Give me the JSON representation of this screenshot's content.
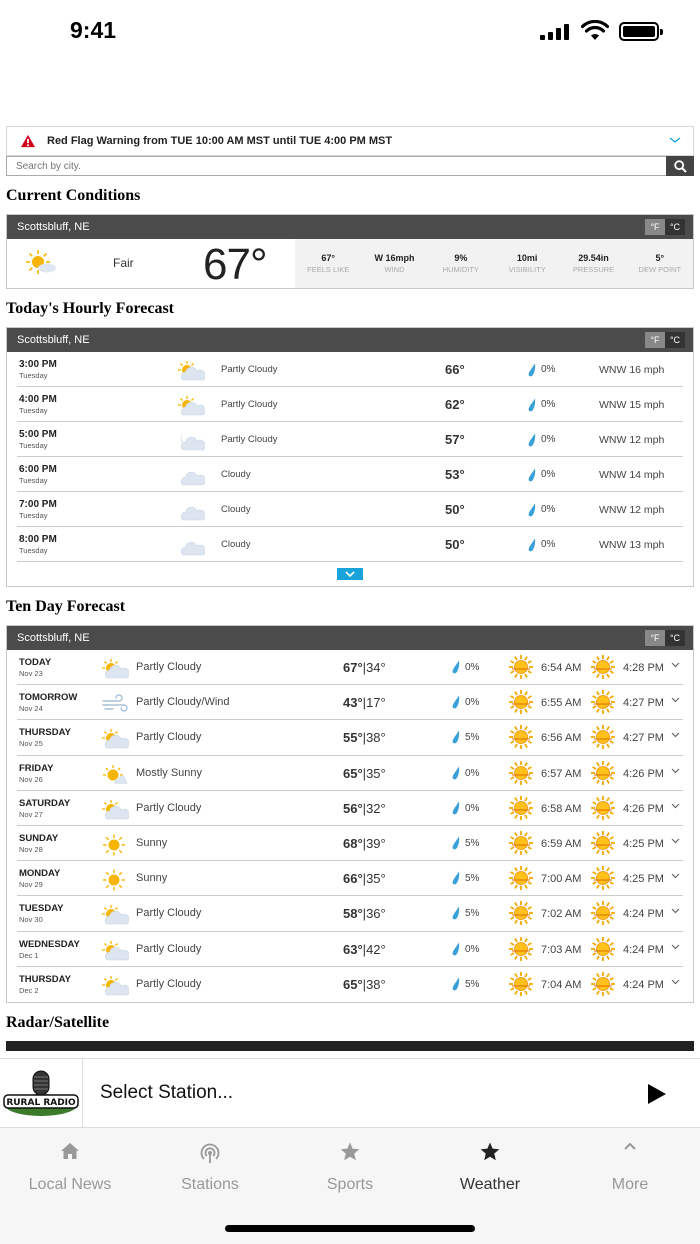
{
  "status_bar": {
    "time": "9:41"
  },
  "alert": {
    "text": "Red Flag Warning from TUE 10:00 AM MST until TUE 4:00 PM MST"
  },
  "search": {
    "placeholder": "Search by city."
  },
  "current": {
    "heading": "Current Conditions",
    "location": "Scottsbluff, NE",
    "unit_f": "°F",
    "unit_c": "°C",
    "condition": "Fair",
    "temp": "67°",
    "stats": [
      {
        "value": "67°",
        "label": "FEELS LIKE"
      },
      {
        "value": "W 16mph",
        "label": "WIND"
      },
      {
        "value": "9%",
        "label": "HUMIDITY"
      },
      {
        "value": "10mi",
        "label": "VISIBILITY"
      },
      {
        "value": "29.54in",
        "label": "PRESSURE"
      },
      {
        "value": "5°",
        "label": "DEW POINT"
      }
    ]
  },
  "hourly": {
    "heading": "Today's Hourly Forecast",
    "location": "Scottsbluff, NE",
    "rows": [
      {
        "time": "3:00 PM",
        "day": "Tuesday",
        "icon": "partly-cloudy-icon",
        "cond": "Partly Cloudy",
        "temp": "66°",
        "precip": "0%",
        "wind": "WNW 16 mph"
      },
      {
        "time": "4:00 PM",
        "day": "Tuesday",
        "icon": "partly-cloudy-icon",
        "cond": "Partly Cloudy",
        "temp": "62°",
        "precip": "0%",
        "wind": "WNW 15 mph"
      },
      {
        "time": "5:00 PM",
        "day": "Tuesday",
        "icon": "partly-cloudy-night-icon",
        "cond": "Partly Cloudy",
        "temp": "57°",
        "precip": "0%",
        "wind": "WNW 12 mph"
      },
      {
        "time": "6:00 PM",
        "day": "Tuesday",
        "icon": "cloudy-icon",
        "cond": "Cloudy",
        "temp": "53°",
        "precip": "0%",
        "wind": "WNW 14 mph"
      },
      {
        "time": "7:00 PM",
        "day": "Tuesday",
        "icon": "cloudy-icon",
        "cond": "Cloudy",
        "temp": "50°",
        "precip": "0%",
        "wind": "WNW 12 mph"
      },
      {
        "time": "8:00 PM",
        "day": "Tuesday",
        "icon": "cloudy-icon",
        "cond": "Cloudy",
        "temp": "50°",
        "precip": "0%",
        "wind": "WNW 13 mph"
      }
    ]
  },
  "tenday": {
    "heading": "Ten Day Forecast",
    "location": "Scottsbluff, NE",
    "rows": [
      {
        "day": "TODAY",
        "date": "Nov 23",
        "icon": "partly-cloudy-icon",
        "cond": "Partly Cloudy",
        "hi": "67°",
        "lo": "34°",
        "precip": "0%",
        "sunrise": "6:54 AM",
        "sunset": "4:28 PM"
      },
      {
        "day": "TOMORROW",
        "date": "Nov 24",
        "icon": "wind-icon",
        "cond": "Partly Cloudy/Wind",
        "hi": "43°",
        "lo": "17°",
        "precip": "0%",
        "sunrise": "6:55 AM",
        "sunset": "4:27 PM"
      },
      {
        "day": "THURSDAY",
        "date": "Nov 25",
        "icon": "partly-cloudy-icon",
        "cond": "Partly Cloudy",
        "hi": "55°",
        "lo": "38°",
        "precip": "5%",
        "sunrise": "6:56 AM",
        "sunset": "4:27 PM"
      },
      {
        "day": "FRIDAY",
        "date": "Nov 26",
        "icon": "mostly-sunny-icon",
        "cond": "Mostly Sunny",
        "hi": "65°",
        "lo": "35°",
        "precip": "0%",
        "sunrise": "6:57 AM",
        "sunset": "4:26 PM"
      },
      {
        "day": "SATURDAY",
        "date": "Nov 27",
        "icon": "partly-cloudy-icon",
        "cond": "Partly Cloudy",
        "hi": "56°",
        "lo": "32°",
        "precip": "0%",
        "sunrise": "6:58 AM",
        "sunset": "4:26 PM"
      },
      {
        "day": "SUNDAY",
        "date": "Nov 28",
        "icon": "sunny-icon",
        "cond": "Sunny",
        "hi": "68°",
        "lo": "39°",
        "precip": "5%",
        "sunrise": "6:59 AM",
        "sunset": "4:25 PM"
      },
      {
        "day": "MONDAY",
        "date": "Nov 29",
        "icon": "sunny-icon",
        "cond": "Sunny",
        "hi": "66°",
        "lo": "35°",
        "precip": "5%",
        "sunrise": "7:00 AM",
        "sunset": "4:25 PM"
      },
      {
        "day": "TUESDAY",
        "date": "Nov 30",
        "icon": "partly-cloudy-icon",
        "cond": "Partly Cloudy",
        "hi": "58°",
        "lo": "36°",
        "precip": "5%",
        "sunrise": "7:02 AM",
        "sunset": "4:24 PM"
      },
      {
        "day": "WEDNESDAY",
        "date": "Dec 1",
        "icon": "partly-cloudy-icon",
        "cond": "Partly Cloudy",
        "hi": "63°",
        "lo": "42°",
        "precip": "0%",
        "sunrise": "7:03 AM",
        "sunset": "4:24 PM"
      },
      {
        "day": "THURSDAY",
        "date": "Dec 2",
        "icon": "partly-cloudy-icon",
        "cond": "Partly Cloudy",
        "hi": "65°",
        "lo": "38°",
        "precip": "5%",
        "sunrise": "7:04 AM",
        "sunset": "4:24 PM"
      }
    ]
  },
  "radar": {
    "heading": "Radar/Satellite"
  },
  "player": {
    "logo_text": "RURAL RADIO",
    "station": "Select Station..."
  },
  "tabs": [
    {
      "label": "Local News",
      "icon": "home-icon"
    },
    {
      "label": "Stations",
      "icon": "broadcast-icon"
    },
    {
      "label": "Sports",
      "icon": "star-icon"
    },
    {
      "label": "Weather",
      "icon": "star-icon",
      "active": true
    },
    {
      "label": "More",
      "icon": "chevron-up-icon"
    }
  ],
  "colors": {
    "header_bg": "#4b4b4b",
    "accent": "#1aa3db",
    "sun": "#f7b500",
    "drop": "#3aa0d8"
  }
}
